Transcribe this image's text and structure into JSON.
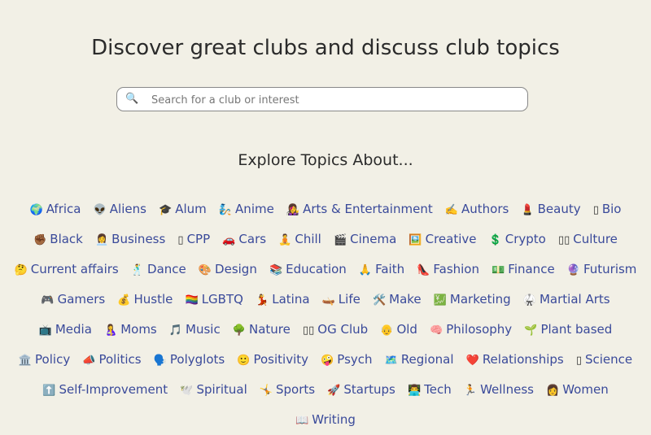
{
  "header": {
    "title": "Discover great clubs and discuss club topics"
  },
  "search": {
    "placeholder": "Search for a club or interest",
    "icon": "🔍"
  },
  "explore": {
    "title": "Explore Topics About..."
  },
  "colors": {
    "background": "#f2f0e6",
    "link": "#3a4a9a"
  },
  "topics": [
    {
      "emoji": "🌍",
      "label": "Africa"
    },
    {
      "emoji": "👽",
      "label": "Aliens"
    },
    {
      "emoji": "🎓",
      "label": "Alum"
    },
    {
      "emoji": "🧞",
      "label": "Anime"
    },
    {
      "emoji": "👩‍🎤",
      "label": "Arts & Entertainment"
    },
    {
      "emoji": "✍️",
      "label": "Authors"
    },
    {
      "emoji": "💄",
      "label": "Beauty"
    },
    {
      "emoji": "▯",
      "label": "Bio"
    },
    {
      "emoji": "✊🏾",
      "label": "Black"
    },
    {
      "emoji": "👩‍💼",
      "label": "Business"
    },
    {
      "emoji": "▯",
      "label": "CPP"
    },
    {
      "emoji": "🚗",
      "label": "Cars"
    },
    {
      "emoji": "🧘",
      "label": "Chill"
    },
    {
      "emoji": "🎬",
      "label": "Cinema"
    },
    {
      "emoji": "🖼️",
      "label": "Creative"
    },
    {
      "emoji": "💲",
      "label": "Crypto"
    },
    {
      "emoji": "▯▯",
      "label": "Culture"
    },
    {
      "emoji": "🤔",
      "label": "Current affairs"
    },
    {
      "emoji": "🕺",
      "label": "Dance"
    },
    {
      "emoji": "🎨",
      "label": "Design"
    },
    {
      "emoji": "📚",
      "label": "Education"
    },
    {
      "emoji": "🙏",
      "label": "Faith"
    },
    {
      "emoji": "👠",
      "label": "Fashion"
    },
    {
      "emoji": "💵",
      "label": "Finance"
    },
    {
      "emoji": "🔮",
      "label": "Futurism"
    },
    {
      "emoji": "🎮",
      "label": "Gamers"
    },
    {
      "emoji": "💰",
      "label": "Hustle"
    },
    {
      "emoji": "🏳️‍🌈",
      "label": "LGBTQ"
    },
    {
      "emoji": "💃",
      "label": "Latina"
    },
    {
      "emoji": "🛶",
      "label": "Life"
    },
    {
      "emoji": "🛠️",
      "label": "Make"
    },
    {
      "emoji": "💹",
      "label": "Marketing"
    },
    {
      "emoji": "🥋",
      "label": "Martial Arts"
    },
    {
      "emoji": "📺",
      "label": "Media"
    },
    {
      "emoji": "🤱",
      "label": "Moms"
    },
    {
      "emoji": "🎵",
      "label": "Music"
    },
    {
      "emoji": "🌳",
      "label": "Nature"
    },
    {
      "emoji": "▯▯",
      "label": "OG Club"
    },
    {
      "emoji": "👴",
      "label": "Old"
    },
    {
      "emoji": "🧠",
      "label": "Philosophy"
    },
    {
      "emoji": "🌱",
      "label": "Plant based"
    },
    {
      "emoji": "🏛️",
      "label": "Policy"
    },
    {
      "emoji": "📣",
      "label": "Politics"
    },
    {
      "emoji": "🗣️",
      "label": "Polyglots"
    },
    {
      "emoji": "🙂",
      "label": "Positivity"
    },
    {
      "emoji": "🤪",
      "label": "Psych"
    },
    {
      "emoji": "🗺️",
      "label": "Regional"
    },
    {
      "emoji": "❤️",
      "label": "Relationships"
    },
    {
      "emoji": "▯",
      "label": "Science"
    },
    {
      "emoji": "⬆️",
      "label": "Self-Improvement"
    },
    {
      "emoji": "🕊️",
      "label": "Spiritual"
    },
    {
      "emoji": "🤸",
      "label": "Sports"
    },
    {
      "emoji": "🚀",
      "label": "Startups"
    },
    {
      "emoji": "👨‍💻",
      "label": "Tech"
    },
    {
      "emoji": "🏃",
      "label": "Wellness"
    },
    {
      "emoji": "👩",
      "label": "Women"
    },
    {
      "emoji": "📖",
      "label": "Writing"
    }
  ]
}
